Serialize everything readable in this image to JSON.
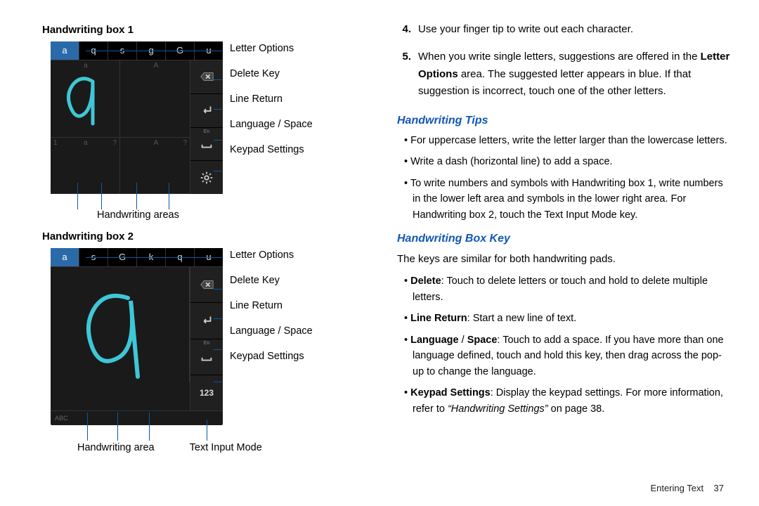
{
  "left": {
    "box1_heading": "Handwriting box 1",
    "box2_heading": "Handwriting box 2",
    "letter_options_1": [
      "a",
      "q",
      "s",
      "g",
      "G",
      "u"
    ],
    "letter_options_2": [
      "a",
      "s",
      "G",
      "k",
      "q",
      "u"
    ],
    "cell_labels_1": {
      "tl": "a",
      "tr": "A",
      "bl_l": "1",
      "bl_c": "a",
      "bl_r": "?",
      "br_c": "A",
      "br_r": "?"
    },
    "box2_abc": "ABC",
    "callouts_1": [
      "Letter Options",
      "Delete Key",
      "Line Return",
      "Language / Space",
      "Keypad Settings"
    ],
    "callouts_2": [
      "Letter Options",
      "Delete Key",
      "Line Return",
      "Language / Space",
      "Keypad Settings"
    ],
    "caption_1": "Handwriting areas",
    "caption_2a": "Handwriting area",
    "caption_2b": "Text Input Mode",
    "key_en": "En",
    "key_123": "123"
  },
  "right": {
    "items": [
      {
        "n": "4.",
        "t": "Use your finger tip to write out each character."
      },
      {
        "n": "5.",
        "t_pre": "When you write single letters, suggestions are offered in the ",
        "t_bold": "Letter Options",
        "t_post": " area. The suggested letter appears in blue. If that suggestion is incorrect, touch one of the other letters."
      }
    ],
    "sub1": "Handwriting Tips",
    "tips": [
      "For uppercase letters, write the letter larger than the lowercase letters.",
      "Write a dash (horizontal line) to add a space.",
      "To write numbers and symbols with Handwriting box 1, write numbers in the lower left area and symbols in the lower right area. For Handwriting box 2, touch the Text Input Mode key."
    ],
    "sub2": "Handwriting Box Key",
    "intro": "The keys are similar for both handwriting pads.",
    "keys": [
      {
        "b": "Delete",
        "t": ": Touch to delete letters or touch and hold to delete multiple letters."
      },
      {
        "b": "Line Return",
        "t": ": Start a new line of text."
      },
      {
        "b": "Language",
        "mid": " / ",
        "b2": "Space",
        "t": ": Touch to add a space. If you have more than one language defined, touch and hold this key, then drag across the pop-up to change the language."
      },
      {
        "b": "Keypad Settings",
        "t": ": Display the keypad settings. For more information, refer to ",
        "i": "“Handwriting Settings”",
        "t2": "  on page 38."
      }
    ]
  },
  "footer": {
    "section": "Entering Text",
    "page": "37"
  }
}
